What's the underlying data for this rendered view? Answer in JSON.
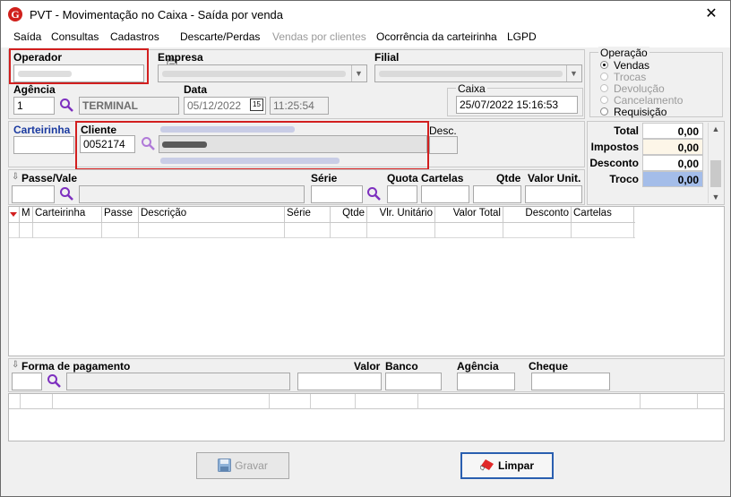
{
  "window": {
    "title": "PVT - Movimentação no Caixa - Saída por venda",
    "close_glyph": "✕"
  },
  "menu": {
    "saida": "Saída",
    "consultas": "Consultas",
    "cadastros": "Cadastros",
    "descarte": "Descarte/Perdas",
    "vendas_clientes": "Vendas por clientes",
    "ocorrencia": "Ocorrência da carteirinha",
    "lgpd": "LGPD"
  },
  "form": {
    "operador_label": "Operador",
    "empresa_label": "Empresa",
    "filial_label": "Filial",
    "agencia_label": "Agência",
    "agencia_value": "1",
    "terminal_value": "TERMINAL",
    "data_label": "Data",
    "data_value": "05/12/2022",
    "calendar_glyph": "15",
    "hora_value": "11:25:54",
    "caixa_label": "Caixa",
    "caixa_value": "25/07/2022 15:16:53",
    "carteirinha_label": "Carteirinha",
    "cliente_label": "Cliente",
    "cliente_code": "0052174",
    "desc_label": "Desc.",
    "passe_label": "Passe/Vale",
    "serie_label": "Série",
    "quota_label": "Quota",
    "cartelas_label": "Cartelas",
    "qtde_label": "Qtde",
    "valor_unit_label": "Valor Unit."
  },
  "operacao": {
    "label": "Operação",
    "options": [
      {
        "label": "Vendas",
        "enabled": true,
        "selected": true
      },
      {
        "label": "Trocas",
        "enabled": false,
        "selected": false
      },
      {
        "label": "Devolução",
        "enabled": false,
        "selected": false
      },
      {
        "label": "Cancelamento",
        "enabled": false,
        "selected": false
      },
      {
        "label": "Requisição",
        "enabled": true,
        "selected": false
      }
    ]
  },
  "totals": {
    "total_label": "Total",
    "total_value": "0,00",
    "impostos_label": "Impostos",
    "impostos_value": "0,00",
    "desconto_label": "Desconto",
    "desconto_value": "0,00",
    "troco_label": "Troco",
    "troco_value": "0,00"
  },
  "grid": {
    "columns": [
      "M",
      "Carteirinha",
      "Passe",
      "Descrição",
      "Série",
      "Qtde",
      "Vlr. Unitário",
      "Valor Total",
      "Desconto",
      "Cartelas"
    ]
  },
  "pagamento": {
    "forma_label": "Forma de pagamento",
    "valor_label": "Valor",
    "banco_label": "Banco",
    "agencia_label": "Agência",
    "cheque_label": "Cheque"
  },
  "buttons": {
    "gravar": "Gravar",
    "limpar": "Limpar"
  },
  "colors": {
    "highlight_red": "#d21f1f",
    "label_blue": "#1a3aa0",
    "troco_blue": "#a4bde9",
    "search_purple": "#7d2fbf"
  }
}
